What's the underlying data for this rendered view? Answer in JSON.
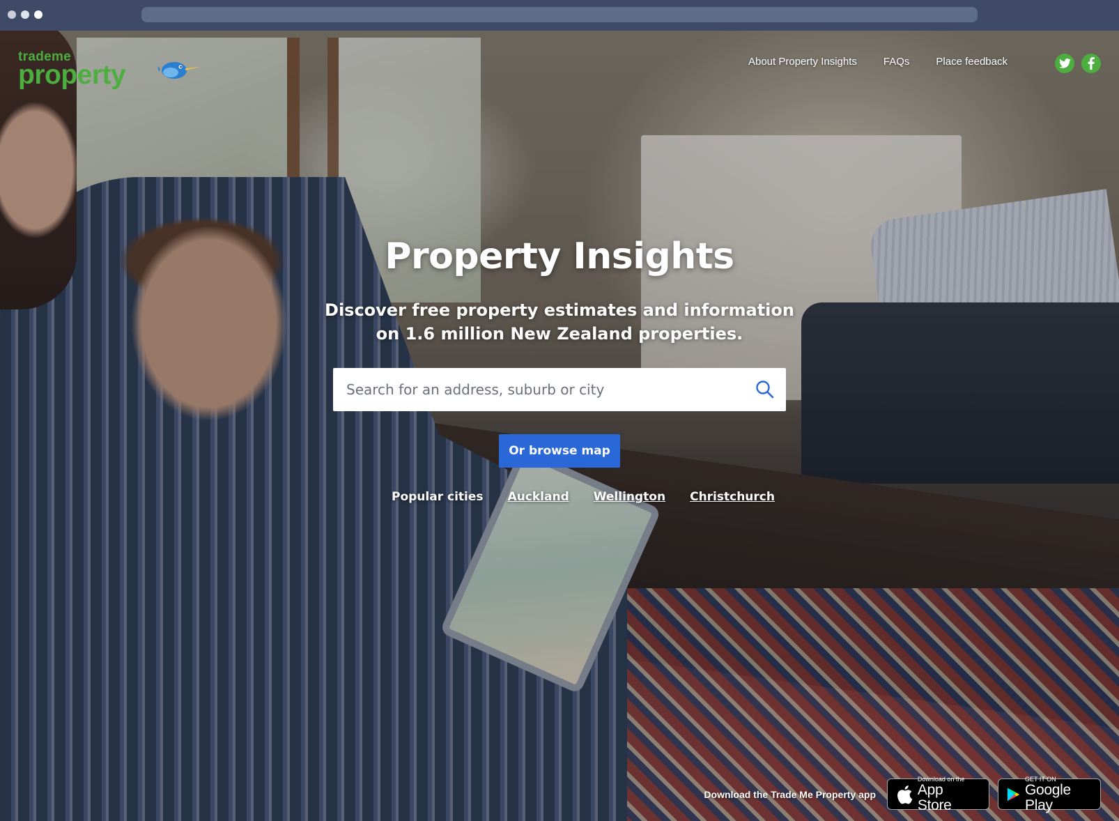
{
  "browser": {},
  "logo": {
    "top_text": "trademe",
    "main_text": "property"
  },
  "nav": {
    "items": [
      {
        "label": "About Property Insights"
      },
      {
        "label": "FAQs"
      },
      {
        "label": "Place feedback"
      }
    ],
    "social": [
      "twitter-icon",
      "facebook-icon"
    ]
  },
  "hero": {
    "title": "Property Insights",
    "subtitle_line1": "Discover free property estimates and information",
    "subtitle_line2": "on 1.6 million New Zealand properties."
  },
  "search": {
    "placeholder": "Search for an address, suburb or city",
    "value": ""
  },
  "browse_button": "Or browse map",
  "popular_cities": {
    "label": "Popular cities",
    "cities": [
      "Auckland",
      "Wellington",
      "Christchurch"
    ]
  },
  "app_download": {
    "label": "Download the Trade Me Property app",
    "apple_small": "Download on the",
    "apple_big": "App Store",
    "google_small": "GET IT ON",
    "google_big": "Google Play"
  },
  "colors": {
    "brand_green": "#4cae3f",
    "button_blue": "#2a68d7",
    "chrome": "#3e4a66"
  }
}
